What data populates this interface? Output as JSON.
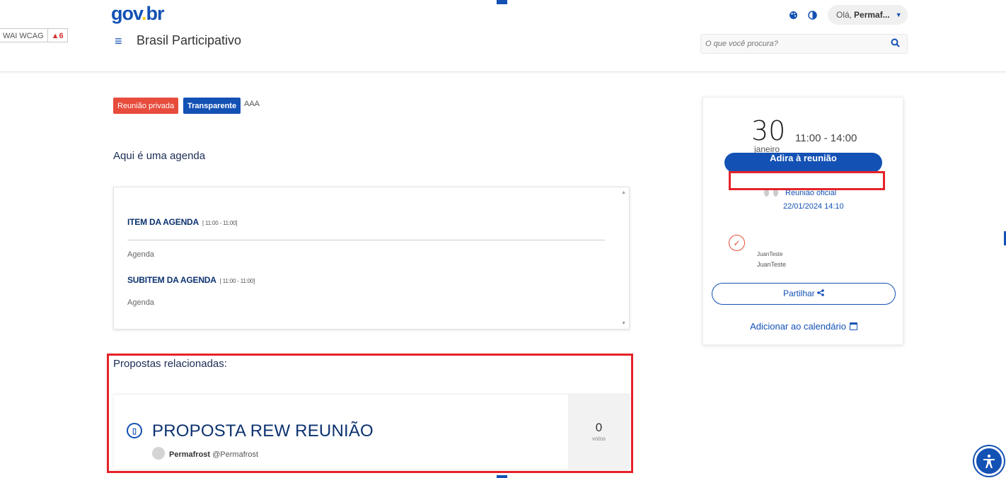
{
  "toolbar": {
    "wcag_label": "WAI WCAG",
    "warnings": "▲6"
  },
  "header": {
    "logo_part1": "gov",
    "logo_part2": ".",
    "logo_part3": "br",
    "menu_icon": "≡",
    "site_title": "Brasil Participativo",
    "greeting": "Olá,",
    "user_name": "Permaf...",
    "search_placeholder": "O que você procura?"
  },
  "meeting": {
    "badge_private": "Reunião privada",
    "badge_transparent": "Transparente",
    "extra_label": "AAA",
    "description": "Aqui é uma agenda"
  },
  "agenda": {
    "items": [
      {
        "title": "ITEM DA AGENDA",
        "time": "[ 11:00 - 11:00]",
        "text": "Agenda"
      },
      {
        "title": "SUBITEM DA AGENDA",
        "time": "[ 11:00 - 11:00]",
        "text": "Agenda"
      }
    ]
  },
  "proposals": {
    "heading": "Propostas relacionadas:",
    "items": [
      {
        "title": "PROPOSTA REW REUNIÃO",
        "author": "Permafrost",
        "handle": "@Permafrost",
        "votes": "0",
        "votes_label": "votos"
      }
    ]
  },
  "side": {
    "day": "30",
    "hours": "11:00 - 14:00",
    "month": "janeiro",
    "join_label": "Adira à reunião",
    "meeting_type": "Reunião oficial",
    "meeting_date": "22/01/2024 14:10",
    "participant_1": "JuanTeste",
    "participant_2": "JuanTeste",
    "share_label": "Partilhar",
    "calendar_label": "Adicionar ao calendário"
  },
  "colors": {
    "primary": "#1351b4",
    "danger": "#e74c3c",
    "highlight": "#e52228",
    "logo_dot": "#ffcd07"
  },
  "icons": [
    "search-icon",
    "theme-icon",
    "contrast-icon",
    "caret-down-icon",
    "proposal-doc-icon",
    "check-circle-icon",
    "share-icon",
    "calendar-icon",
    "accessibility-icon"
  ]
}
